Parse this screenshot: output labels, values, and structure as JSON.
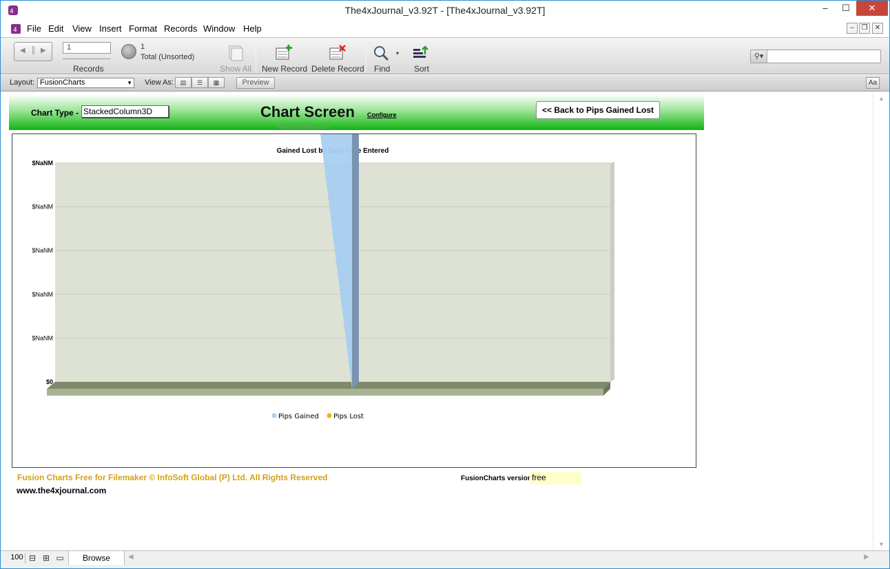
{
  "window": {
    "title": "The4xJournal_v3.92T - [The4xJournal_v3.92T]"
  },
  "menu": [
    "File",
    "Edit",
    "View",
    "Insert",
    "Format",
    "Records",
    "Window",
    "Help"
  ],
  "toolbar": {
    "record_number": "1",
    "records_label": "Records",
    "found_count": "1",
    "total_label": "Total (Unsorted)",
    "show_all": "Show All",
    "new_record": "New Record",
    "delete_record": "Delete Record",
    "find": "Find",
    "sort": "Sort"
  },
  "layoutbar": {
    "layout_label": "Layout:",
    "layout_value": "FusionCharts",
    "view_as_label": "View As:",
    "preview": "Preview",
    "aa": "Aa"
  },
  "header": {
    "chart_type_label": "Chart Type -",
    "chart_type_value": "StackedColumn3D",
    "title": "Chart Screen",
    "configure": "Configure",
    "watermark": "www.softpedia.com",
    "back_button": "<< Back to Pips Gained Lost"
  },
  "chart_data": {
    "type": "bar",
    "stacked": true,
    "three_d": true,
    "title": "Gained Lost by Date Time Entered",
    "ytick_labels": [
      "$NaNM",
      "$NaNM",
      "$NaNM",
      "$NaNM",
      "$NaNM",
      "$0"
    ],
    "categories": [],
    "series": [
      {
        "name": "Pips Gained",
        "values": [],
        "color": "#a8cff0"
      },
      {
        "name": "Pips Lost",
        "values": [],
        "color": "#f2b318"
      }
    ],
    "legend_position": "bottom",
    "grid": true,
    "plot_color": "#dde2d5"
  },
  "footer": {
    "copyright": "Fusion Charts Free for Filemaker © InfoSoft Global (P) Ltd. All Rights Reserved",
    "website": "www.the4xjournal.com",
    "version_label": "FusionCharts version",
    "version_value": "free"
  },
  "statusbar": {
    "zoom": "100",
    "mode": "Browse"
  },
  "colors": {
    "header_green": "#11b311",
    "accent": "#2a8dd4",
    "footer_gold": "#d4a017"
  }
}
